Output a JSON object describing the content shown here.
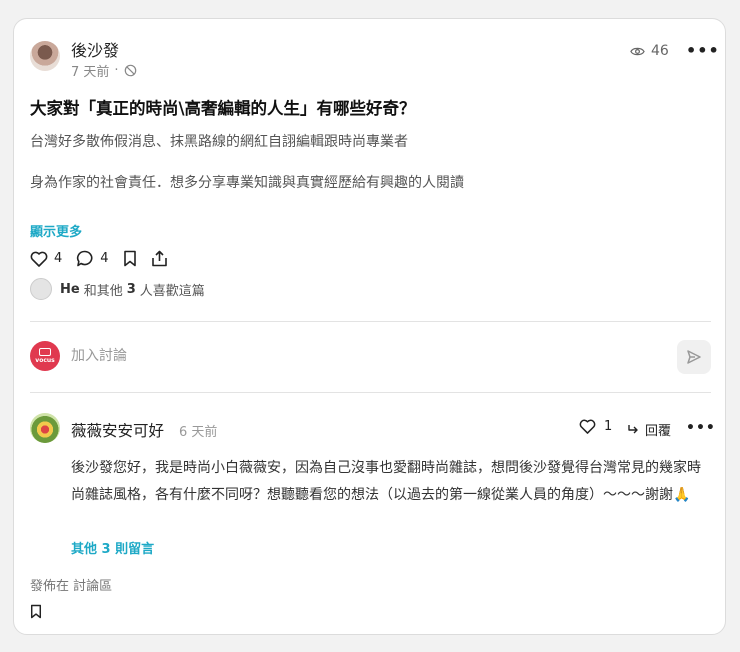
{
  "post": {
    "author": "後沙發",
    "time": "7 天前",
    "separator": "·",
    "views": "46",
    "title": "大家對「真正的時尚\\高奢編輯的人生」有哪些好奇？",
    "body_line1": "台灣好多散佈假消息、抹黑路線的網紅自詡編輯跟時尚專業者",
    "body_line2": "身為作家的社會責任．想多分享專業知識與真實經歷給有興趣的人閱讀",
    "show_more": "顯示更多",
    "likes": "4",
    "comments": "4",
    "liked_by_name": "He",
    "liked_by_mid": "和其他",
    "liked_by_count": "3",
    "liked_by_suffix": "人喜歡這篇"
  },
  "comment_box": {
    "avatar_text": "vocus",
    "placeholder": "加入討論"
  },
  "comment": {
    "author": "薇薇安安可好",
    "time": "6 天前",
    "likes": "1",
    "reply": "回覆",
    "text": "後沙發您好，我是時尚小白薇薇安，因為自己沒事也愛翻時尚雜誌，想問後沙發覺得台灣常見的幾家時尚雜誌風格，各有什麼不同呀？想聽聽看您的想法（以過去的第一線從業人員的角度）～～～謝謝🙏",
    "other_replies": "其他 3 則留言"
  },
  "footer": {
    "posted_in": "發佈在 討論區"
  },
  "colors": {
    "accent": "#1ea9c6",
    "brand": "#e0394f"
  }
}
